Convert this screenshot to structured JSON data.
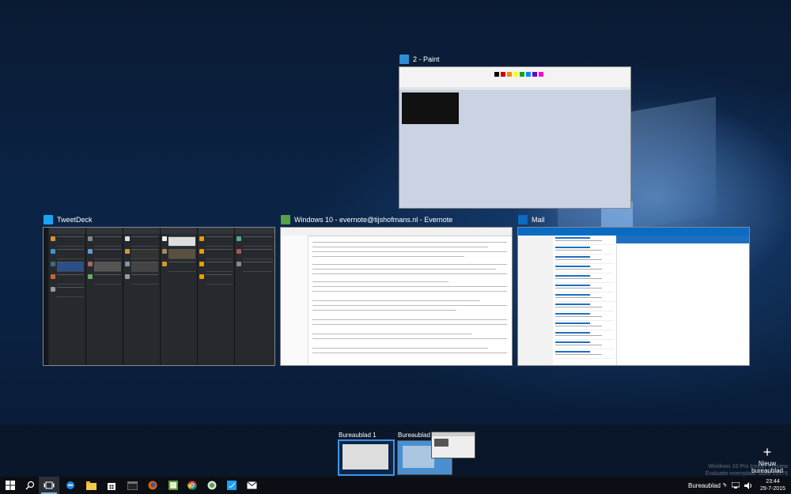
{
  "windows": [
    {
      "id": "paint",
      "title": "2 - Paint",
      "icon": "paint-icon",
      "color": "#2b8fd6"
    },
    {
      "id": "tweetdeck",
      "title": "TweetDeck",
      "icon": "tweetdeck-icon",
      "color": "#1da1f2"
    },
    {
      "id": "evernote",
      "title": "Windows 10 - evernote@tijshofmans.nl - Evernote",
      "icon": "evernote-icon",
      "color": "#55a14a"
    },
    {
      "id": "mail",
      "title": "Mail",
      "icon": "mail-icon",
      "color": "#0a6bc2"
    }
  ],
  "desktops": [
    {
      "label": "Bureaublad 1",
      "selected": true
    },
    {
      "label": "Bureaublad 2",
      "selected": false
    }
  ],
  "new_desktop": {
    "label": "Nieuw bureaublad"
  },
  "watermark": {
    "line1": "Windows 10 Pro Insider Preview",
    "line2": "Evaluatie-exemplaar. Build 10176"
  },
  "taskbar": {
    "buttons": [
      "start",
      "search",
      "task-view",
      "edge",
      "file-explorer",
      "store",
      "firefox",
      "paint",
      "chrome",
      "evernote",
      "tweetdeck",
      "mail"
    ],
    "tray_label": "Bureaublad",
    "clock": {
      "time": "23:44",
      "date": "29-7-2015"
    }
  }
}
